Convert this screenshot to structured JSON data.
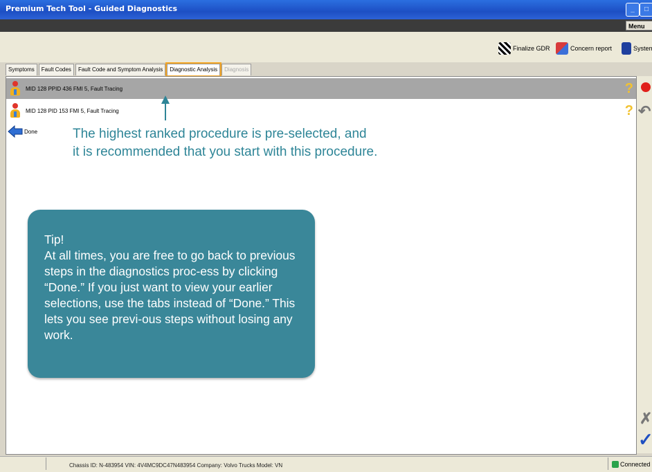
{
  "window": {
    "title": "Premium Tech Tool - Guided Diagnostics",
    "min_glyph": "_",
    "max_glyph": "□",
    "menu_label": "Menu"
  },
  "toolbar": {
    "finalize_label": "Finalize GDR",
    "concern_label": "Concern report",
    "system_label": "System"
  },
  "tabs": [
    {
      "label": "Symptoms",
      "state": "normal"
    },
    {
      "label": "Fault Codes",
      "state": "normal"
    },
    {
      "label": "Fault Code and Symptom Analysis",
      "state": "normal"
    },
    {
      "label": "Diagnostic Analysis",
      "state": "active"
    },
    {
      "label": "Diagnosis",
      "state": "disabled"
    }
  ],
  "procedures": [
    {
      "label": "MID 128 PPID 436 FMI 5, Fault Tracing",
      "selected": true,
      "help": "?"
    },
    {
      "label": "MID 128 PID 153 FMI 5, Fault Tracing",
      "selected": false,
      "help": "?"
    }
  ],
  "done_label": "Done",
  "callout": {
    "text_line1": "The highest ranked procedure is pre-selected, and",
    "text_line2": "it is recommended that you start with this procedure."
  },
  "tip": {
    "title": "Tip!",
    "body": "At all times, you are free to go back to previous steps in the diagnostics proc-ess by clicking “Done.” If you just want to view your earlier selections, use the tabs instead of “Done.” This lets you see previ-ous steps without losing any work."
  },
  "side_icons": {
    "back": "↶",
    "cancel": "✗",
    "confirm": "✓"
  },
  "status": {
    "info": "Chassis ID: N-483954   VIN: 4V4MC9DC47N483954   Company: Volvo Trucks   Model: VN",
    "connection": "Connected"
  },
  "colors": {
    "accent_teal": "#3a8799",
    "titlebar_blue": "#1d4fc4",
    "selected_row": "#a6a6a6",
    "active_tab_outline": "#f5a623"
  }
}
